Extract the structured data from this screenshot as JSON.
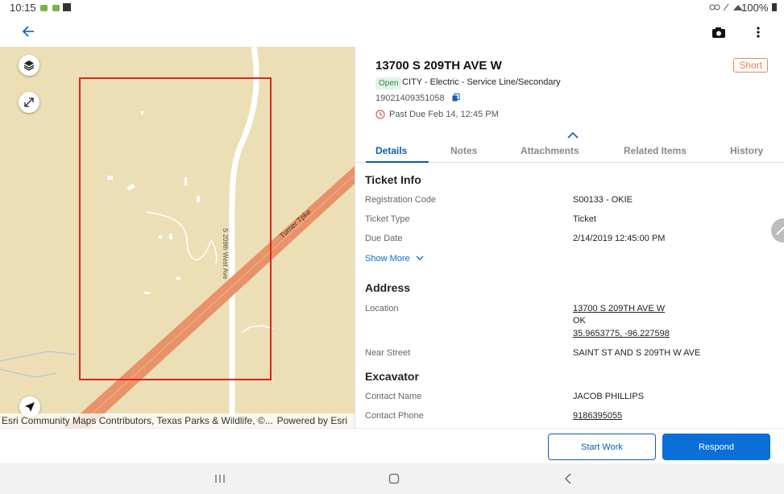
{
  "status_bar": {
    "time": "10:15",
    "battery": "100%"
  },
  "colors": {
    "accent": "#0a5fb4",
    "short_badge": "#e8844a",
    "open_badge": "#2e8b3e",
    "pastdue_icon": "#e05a4a",
    "map_base": "#ecdfb6",
    "road_highway": "#e8926a",
    "selection_box": "#e0251b"
  },
  "toolbar": {
    "back_icon": "arrow-left-icon",
    "camera_icon": "camera-icon",
    "menu_icon": "more-vert-icon"
  },
  "map": {
    "attribution": "Esri Community Maps Contributors, Texas Parks & Wildlife, ©...",
    "powered_by": "Powered by Esri",
    "road_label_1": "S 209th West Ave",
    "road_label_2": "Turner Tpke",
    "buttons": [
      "layers-icon",
      "expand-icon",
      "navigation-icon"
    ]
  },
  "ticket": {
    "address_title": "13700 S 209TH AVE W",
    "priority": "Short",
    "status": "Open",
    "category": "CITY - Electric - Service Line/Secondary",
    "ticket_number": "19021409351058",
    "past_due": "Past Due Feb 14, 12:45 PM"
  },
  "tabs": [
    "Details",
    "Notes",
    "Attachments",
    "Related Items",
    "History"
  ],
  "details": {
    "ticket_info_heading": "Ticket Info",
    "registration_code_label": "Registration Code",
    "registration_code": "S00133 - OKIE",
    "ticket_type_label": "Ticket Type",
    "ticket_type": "Ticket",
    "due_date_label": "Due Date",
    "due_date": "2/14/2019 12:45:00 PM",
    "show_more": "Show More",
    "address_heading": "Address",
    "location_label": "Location",
    "location_line1": "13700 S 209TH AVE W",
    "location_line2": "OK",
    "location_coords": "35.9653775, -96.227598",
    "near_street_label": "Near Street",
    "near_street": "SAINT ST AND S 209TH W AVE",
    "excavator_heading": "Excavator",
    "contact_name_label": "Contact Name",
    "contact_name": "JACOB PHILLIPS",
    "contact_phone_label": "Contact Phone",
    "contact_phone": "9186395055"
  },
  "actions": {
    "start_work": "Start Work",
    "respond": "Respond"
  }
}
